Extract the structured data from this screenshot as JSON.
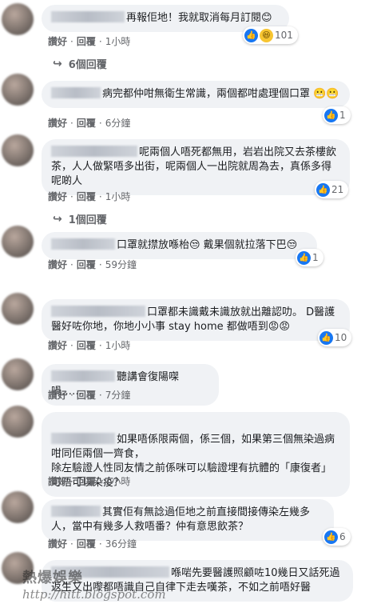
{
  "actions": {
    "like": "讚好",
    "reply": "回覆",
    "sep": "·"
  },
  "comments": [
    {
      "text": "再報佢地！我就取消每月訂閱😊",
      "time": "1小時",
      "reactions": "101",
      "replies": "6個回覆"
    },
    {
      "text": "病完都仲咁無衛生常識，兩個都咁處理個口罩 😬😬",
      "time": "6分鐘",
      "reactions": "1"
    },
    {
      "text": "呢兩個人唔死都無用，岩岩出院又去茶樓飲茶，人人做緊唔多出街，呢兩個人一出院就周為去，真係多得呢啲人",
      "time": "1小時",
      "reactions": "21",
      "replies": "1個回覆"
    },
    {
      "text": "口罩就㩒放喺枱😒 戴果個就拉落下巴😒",
      "time": "59分鐘",
      "reactions": "1"
    },
    {
      "text": "口罩都未識戴未識放就出離認叻。 D醫護醫好咗你地，你地小小事 stay home 都做唔到😡😡",
      "time": "1小時",
      "reactions": "10"
    },
    {
      "text": "聽講會復陽㗎喎……",
      "time": "7分鐘"
    },
    {
      "text": "如果唔係限兩個，係三個，如果第三個無染過病咁同佢兩個一齊食，\n除左驗證人性同友情之前係咪可以驗證埋有抗體的「康復者」可唔可以染疫？",
      "time": "1小時"
    },
    {
      "text": "其實佢有無諗過佢地之前直接間接傳染左幾多人，當中有幾多人救唔番？仲有意思飲茶？",
      "time": "36分鐘",
      "reactions": "6"
    },
    {
      "text": "喺啱先要醫護照顧咗10幾日又話死過返生又出嚟都唔識自己自律下走去嘆茶，不如之前唔好醫"
    }
  ],
  "watermark": {
    "title": "熱爆娛樂",
    "url": "http://hitt.blogspot.com"
  }
}
